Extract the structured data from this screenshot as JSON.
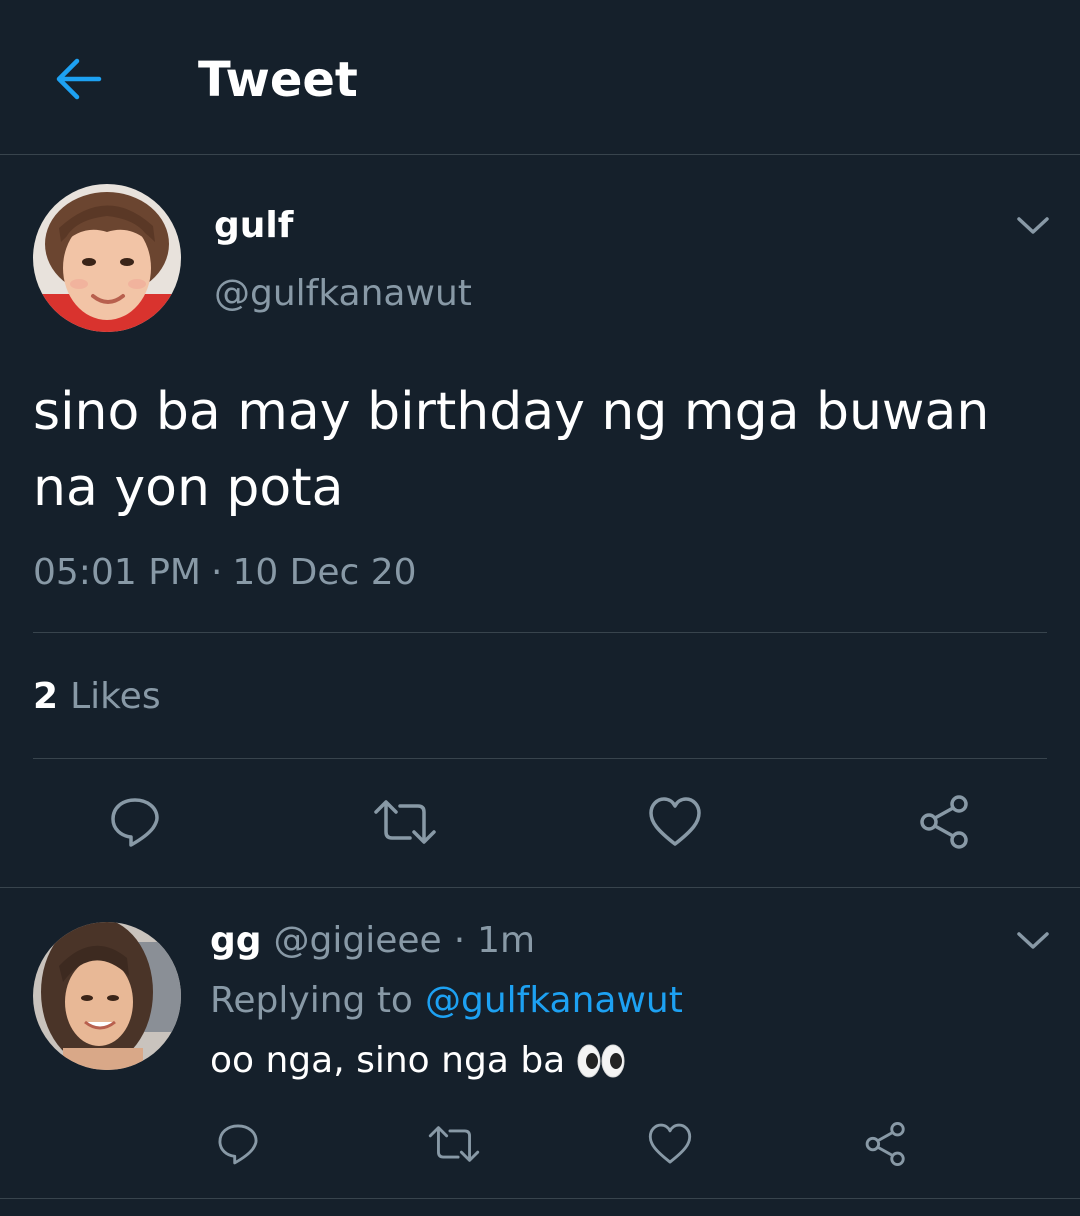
{
  "header": {
    "title": "Tweet",
    "back_icon": "arrow-left-icon",
    "accent_color": "#1da1f2"
  },
  "tweet": {
    "display_name": "gulf",
    "handle": "@gulfkanawut",
    "text": "sino ba may birthday ng mga buwan na yon pota",
    "time": "05:01 PM",
    "separator": "·",
    "date": "10 Dec 20",
    "likes_count": "2",
    "likes_label": "Likes",
    "actions": [
      "reply-icon",
      "retweet-icon",
      "like-icon",
      "share-icon"
    ]
  },
  "reply": {
    "display_name": "gg",
    "handle": "@gigieee",
    "separator": "·",
    "time": "1m",
    "replying_label": "Replying to",
    "replying_to": "@gulfkanawut",
    "text": "oo nga, sino nga ba",
    "emoji_icon": "eyes-emoji-icon"
  },
  "colors": {
    "background": "#15202b",
    "secondary_text": "#8899a6",
    "divider": "#38444d",
    "link": "#1da1f2"
  }
}
